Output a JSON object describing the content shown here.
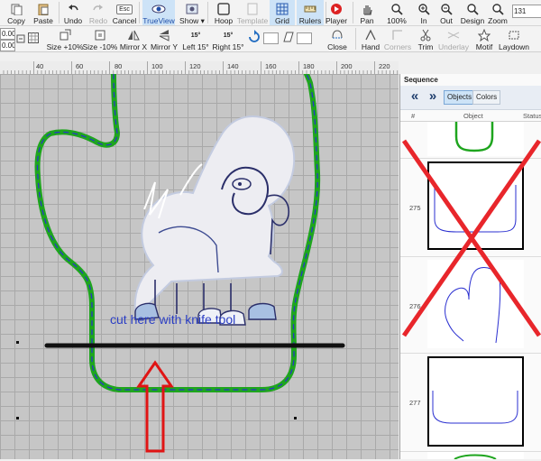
{
  "toolbar1": {
    "buttons": [
      {
        "label": "Copy",
        "enabled": true
      },
      {
        "label": "Paste",
        "enabled": true
      },
      {
        "label": "Undo",
        "enabled": true
      },
      {
        "label": "Redo",
        "enabled": false
      },
      {
        "label": "Cancel",
        "key_hint": "Esc",
        "enabled": true
      },
      {
        "label": "TrueView",
        "enabled": true,
        "active": true
      },
      {
        "label": "Show",
        "enabled": true,
        "has_dropdown": true
      },
      {
        "label": "Hoop",
        "enabled": true
      },
      {
        "label": "Template",
        "enabled": false
      },
      {
        "label": "Grid",
        "enabled": true,
        "active": true
      },
      {
        "label": "Rulers",
        "enabled": true,
        "active": true
      },
      {
        "label": "Player",
        "enabled": true
      },
      {
        "label": "Pan",
        "enabled": true
      },
      {
        "label": "100%",
        "enabled": true
      },
      {
        "label": "In",
        "enabled": true
      },
      {
        "label": "Out",
        "enabled": true
      },
      {
        "label": "Design",
        "enabled": true
      },
      {
        "label": "Zoom",
        "enabled": true
      }
    ],
    "zoom_value": "131"
  },
  "toolbar2": {
    "field_values": [
      "0.00",
      "0.00"
    ],
    "buttons": [
      {
        "label": "Size +10%"
      },
      {
        "label": "Size -10%"
      },
      {
        "label": "Mirror X"
      },
      {
        "label": "Mirror Y"
      },
      {
        "label": "Left 15°",
        "badge": "15°"
      },
      {
        "label": "Right 15°",
        "badge": "15°"
      },
      {
        "label": "Close"
      },
      {
        "label": "Hand"
      },
      {
        "label": "Corners",
        "enabled": false
      },
      {
        "label": "Trim"
      },
      {
        "label": "Underlay",
        "enabled": false
      },
      {
        "label": "Motif"
      },
      {
        "label": "Laydown"
      }
    ]
  },
  "ruler": {
    "ticks": [
      "40",
      "60",
      "80",
      "100",
      "120",
      "140",
      "160",
      "180",
      "200",
      "220"
    ]
  },
  "canvas": {
    "annotation": "cut here with knife tool",
    "colors": {
      "grid_bg": "#c6c6c6",
      "green_outline": "#1ea51e",
      "blue_stitch": "#2a2fd0",
      "cut_line": "#111111",
      "arrow": "#e01414",
      "annotation": "#2b3ec4"
    }
  },
  "sequence_panel": {
    "title": "Sequence",
    "tabs": [
      "Objects",
      "Colors"
    ],
    "active_tab": "Objects",
    "columns": [
      "#",
      "Object",
      "Status"
    ],
    "rows": [
      {
        "number": "",
        "shape": "green-cuff",
        "selected": false,
        "crossed": false
      },
      {
        "number": "275",
        "shape": "cuff-outline",
        "selected": true,
        "crossed": true
      },
      {
        "number": "276",
        "shape": "mitten-outline",
        "selected": false,
        "crossed": false
      },
      {
        "number": "277",
        "shape": "cuff-outline",
        "selected": true,
        "crossed": false
      }
    ]
  }
}
